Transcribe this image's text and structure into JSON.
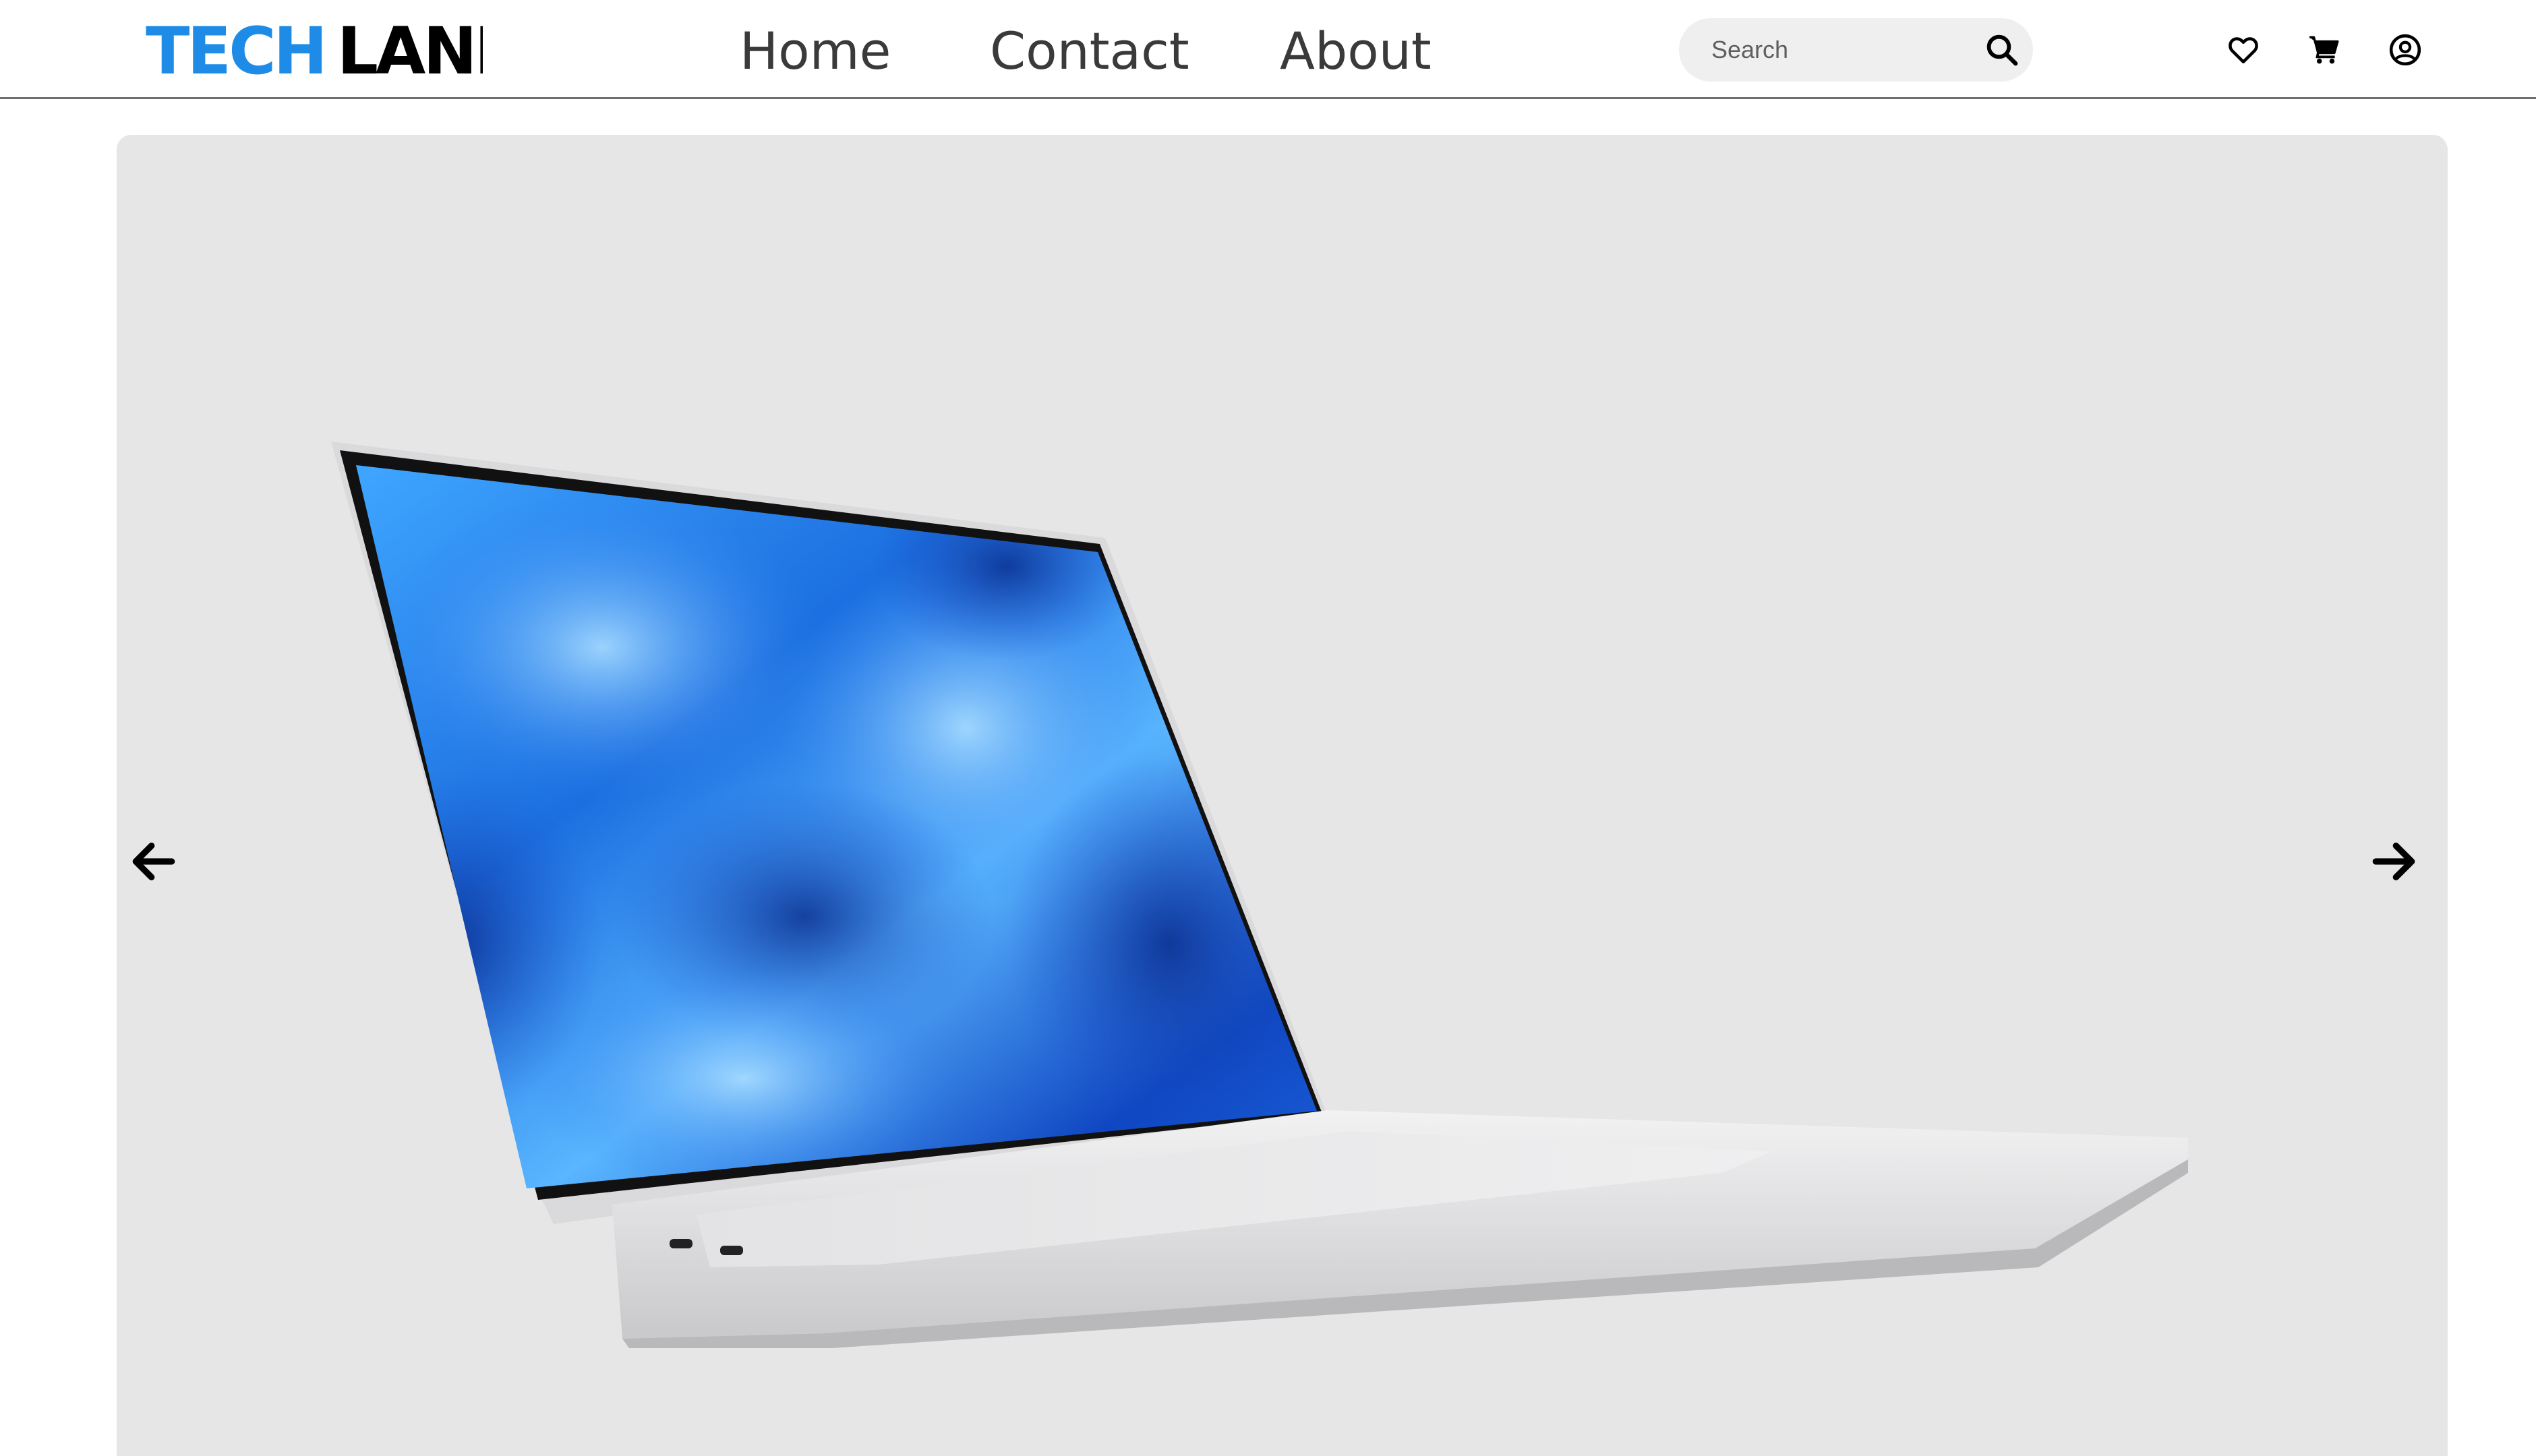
{
  "header": {
    "logo": {
      "part1": "TECH",
      "part2": "LANE",
      "part1_color": "#1e8ce6",
      "part2_color": "#000000"
    },
    "nav": [
      {
        "label": "Home"
      },
      {
        "label": "Contact"
      },
      {
        "label": "About"
      }
    ],
    "search": {
      "placeholder": "Search",
      "value": "",
      "icon": "search-icon"
    },
    "icons": [
      "heart-icon",
      "cart-icon",
      "account-icon"
    ]
  },
  "hero": {
    "image": "laptop-image",
    "prev_icon": "arrow-left-icon",
    "next_icon": "arrow-right-icon",
    "background_color": "#e6e6e6"
  },
  "colors": {
    "accent": "#1e8ce6",
    "header_border": "#6e6e6e",
    "search_bg": "#efefef"
  }
}
